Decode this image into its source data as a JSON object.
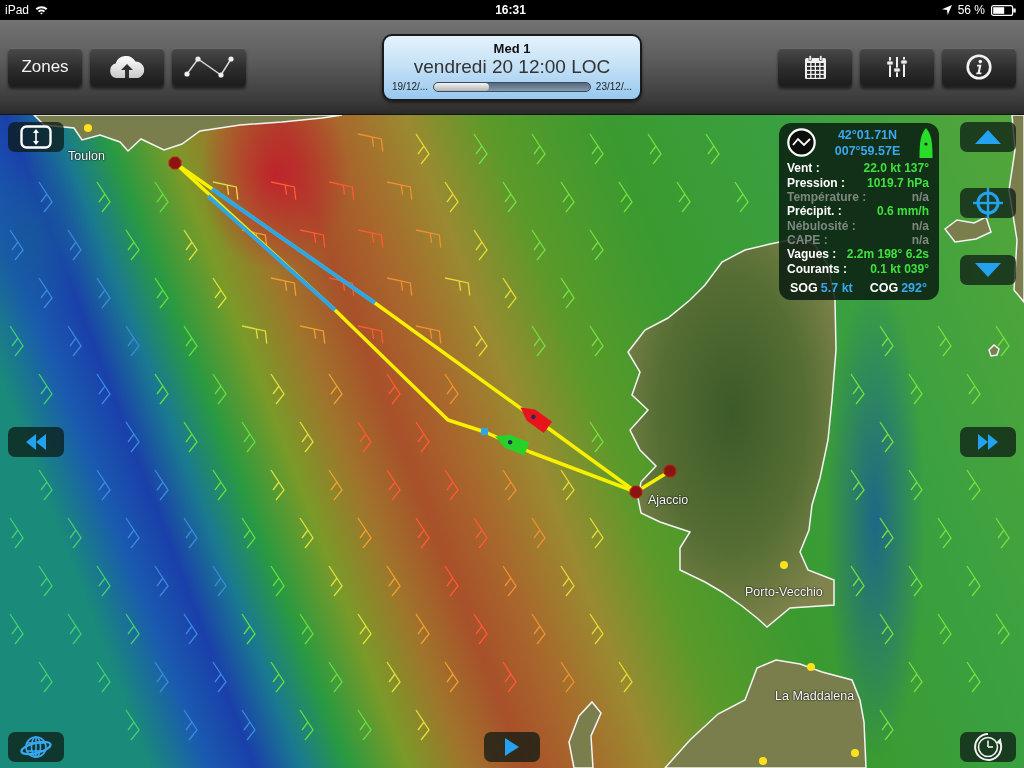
{
  "status_bar": {
    "device": "iPad",
    "time": "16:31",
    "battery": "56 %"
  },
  "toolbar": {
    "zones_button": "Zones"
  },
  "date_panel": {
    "region": "Med 1",
    "datetime": "vendredi 20 12:00 LOC",
    "start": "19/12/...",
    "end": "23/12/...",
    "level": 0.35
  },
  "map": {
    "places": [
      {
        "name": "Toulon"
      },
      {
        "name": "Ajaccio"
      },
      {
        "name": "Porto-Vecchio"
      },
      {
        "name": "La Maddalena"
      }
    ],
    "boats": [
      {
        "color": "#e8141c"
      },
      {
        "color": "#28d028"
      }
    ]
  },
  "info_panel": {
    "latitude": "42°01.71N",
    "longitude": "007°59.57E",
    "rows": [
      {
        "label": "Vent :",
        "value": "22.0 kt 137°",
        "disabled": false
      },
      {
        "label": "Pression :",
        "value": "1019.7 hPa",
        "disabled": false
      },
      {
        "label": "Température :",
        "value": "n/a",
        "disabled": true
      },
      {
        "label": "Précipit. :",
        "value": "0.6 mm/h",
        "disabled": false
      },
      {
        "label": "Nébulosité :",
        "value": "n/a",
        "disabled": true
      },
      {
        "label": "CAPE :",
        "value": "n/a",
        "disabled": true
      },
      {
        "label": "Vagues :",
        "value": "2.2m 198° 6.2s",
        "disabled": false
      },
      {
        "label": "Courants :",
        "value": "0.1 kt 039°",
        "disabled": false
      }
    ],
    "sog_label": "SOG",
    "sog": "5.7 kt",
    "cog_label": "COG",
    "cog": "292°"
  }
}
